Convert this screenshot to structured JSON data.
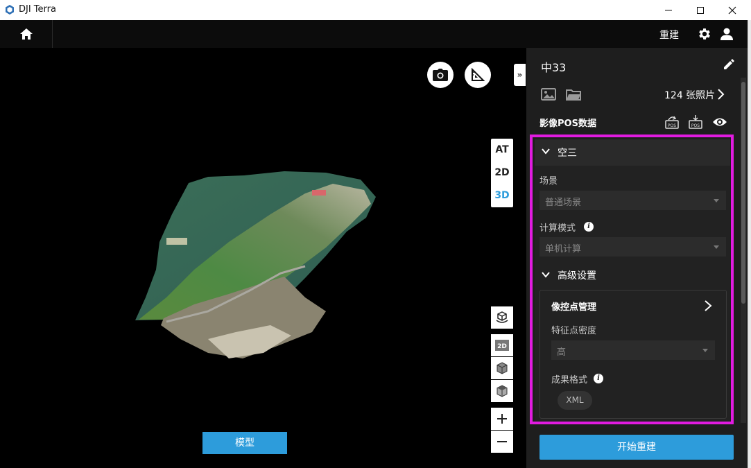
{
  "window": {
    "title": "DJI Terra"
  },
  "topnav": {
    "active_tab": "重建"
  },
  "viewport": {
    "view_modes": [
      "AT",
      "2D",
      "3D"
    ],
    "active_view": "3D",
    "display_toggle_label": "模型"
  },
  "panel": {
    "project_name": "中33",
    "photo_count": "124 张照片",
    "pos_label": "影像POS数据",
    "at_section": {
      "title": "空三",
      "scene_label": "场景",
      "scene_value": "普通场景",
      "mode_label": "计算模式",
      "mode_value": "单机计算",
      "advanced_title": "高级设置",
      "gcp_label": "像控点管理",
      "density_label": "特征点密度",
      "density_value": "高",
      "format_label": "成果格式",
      "format_value": "XML"
    },
    "start_button": "开始重建"
  },
  "colors": {
    "accent": "#2d9cdb",
    "highlight": "#e11be0",
    "panel_bg": "#1e1e1e"
  }
}
